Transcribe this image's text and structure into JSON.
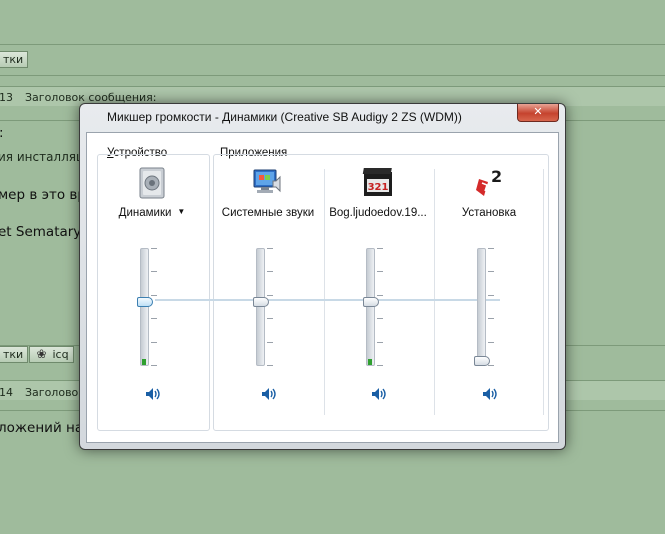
{
  "background": {
    "btn1_label": "тки",
    "row1_num": "13",
    "row1_header": "Заголовок сообщения:",
    "row2_colon": ":",
    "row3_text": "ия инсталляц",
    "row4_text": "мер в это вр",
    "row5_text": "et Sematary",
    "btn2_label": "тки",
    "icq_label": "icq",
    "row6_num": "14",
    "row6_header": "Заголовок",
    "row7_text": "ложений на"
  },
  "window": {
    "title": "Микшер громкости - Динамики (Creative SB Audigy 2 ZS (WDM))",
    "device_group": "Устройство",
    "device_group_underlined": "У",
    "device_group_rest": "стройство",
    "apps_group": "Приложения"
  },
  "channels": [
    {
      "label": "Динамики",
      "icon": "speaker-device-icon",
      "dropdown": true,
      "volume": 0.55,
      "meter": 0.05,
      "focused": true
    },
    {
      "label": "Системные звуки",
      "icon": "system-sounds-icon",
      "volume": 0.55,
      "meter": 0.0
    },
    {
      "label": "Bog.ljudoedov.19...",
      "icon": "media-player-321-icon",
      "volume": 0.55,
      "meter": 0.05
    },
    {
      "label": "Установка",
      "icon": "installer-icon",
      "volume": 0.0,
      "meter": 0.0
    }
  ],
  "colors": {
    "accent": "#3c7fb1",
    "meter_green": "#2fa02f",
    "close_red": "#c5432e"
  }
}
